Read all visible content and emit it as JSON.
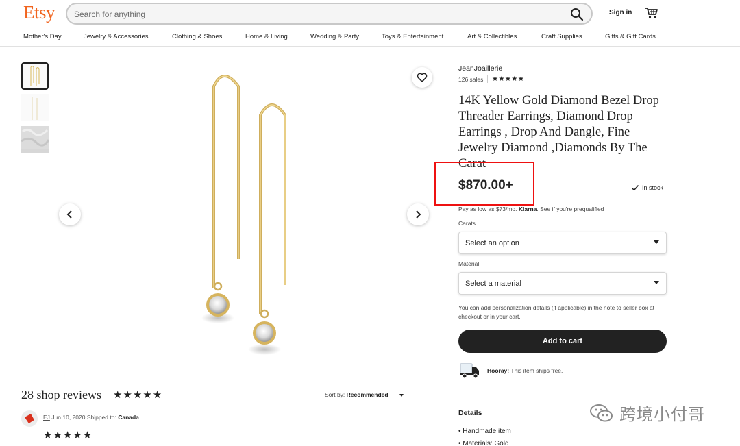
{
  "header": {
    "logo": "Etsy",
    "search_placeholder": "Search for anything",
    "signin": "Sign in"
  },
  "nav": {
    "items": [
      "Mother's Day",
      "Jewelry & Accessories",
      "Clothing & Shoes",
      "Home & Living",
      "Wedding & Party",
      "Toys & Entertainment",
      "Art & Collectibles",
      "Craft Supplies",
      "Gifts & Gift Cards"
    ]
  },
  "product": {
    "shop_name": "JeanJoaillerie",
    "sales": "126 sales",
    "shop_rating_stars": "★★★★★",
    "title": "14K Yellow Gold Diamond Bezel Drop Threader Earrings, Diamond Drop Earrings , Drop And Dangle, Fine Jewelry Diamond ,Diamonds By The Carat",
    "price": "$870.00+",
    "stock": "In stock",
    "klarna_prefix": "Pay as low as ",
    "klarna_amount": "$73/mo",
    "klarna_brand": "Klarna",
    "klarna_link": "See if you're prequalified",
    "carats_label": "Carats",
    "carats_value": "Select an option",
    "material_label": "Material",
    "material_value": "Select a material",
    "personalization_note": "You can add personalization details (if applicable) in the note to seller box at checkout or in your cart.",
    "add_to_cart": "Add to cart",
    "ship_bold": "Hooray!",
    "ship_text": " This item ships free."
  },
  "reviews": {
    "title": "28 shop reviews",
    "stars": "★★★★★",
    "sort_prefix": "Sort by: ",
    "sort_value": "Recommended",
    "first": {
      "name": "EJ",
      "date": "Jun 10, 2020",
      "shipped_prefix": "Shipped to: ",
      "shipped_to": "Canada",
      "stars": "★★★★★"
    }
  },
  "details": {
    "title": "Details",
    "items": [
      "Handmade item",
      "Materials: Gold"
    ]
  },
  "watermark": "跨境小付哥",
  "colors": {
    "brand": "#f1641e",
    "button": "#222222",
    "highlight": "#ee1111"
  }
}
